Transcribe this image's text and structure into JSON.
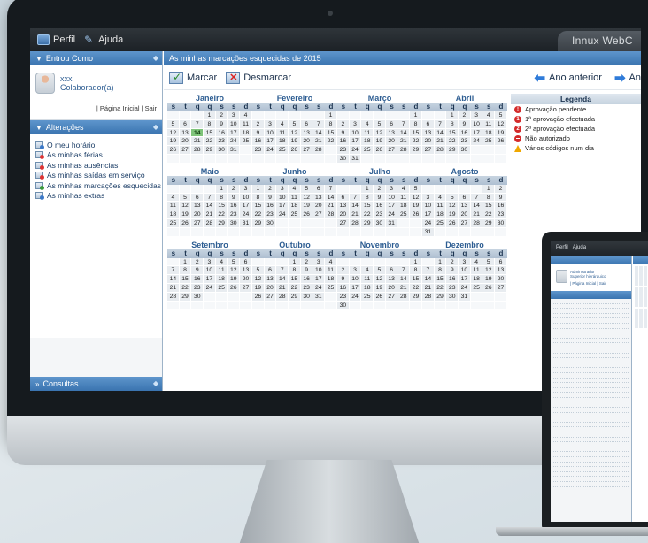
{
  "topbar": {
    "profile_label": "Perfil",
    "help_label": "Ajuda",
    "brand": "Innux WebC"
  },
  "left": {
    "login_header": "Entrou Como",
    "user_name": "xxx",
    "user_role": "Colaborador(a)",
    "user_links": "| Página Inicial | Sair",
    "changes_header": "Alterações",
    "menu": [
      {
        "label": "O meu horário",
        "icon": "blue"
      },
      {
        "label": "As minhas férias",
        "icon": "red"
      },
      {
        "label": "As minhas ausências",
        "icon": "red"
      },
      {
        "label": "As minhas saídas em serviço",
        "icon": "red"
      },
      {
        "label": "As minhas marcações esquecidas",
        "icon": "green"
      },
      {
        "label": "As minhas extras",
        "icon": "blue"
      }
    ],
    "queries_header": "Consultas"
  },
  "main": {
    "header": "As minhas marcações esquecidas de 2015",
    "mark_label": "Marcar",
    "unmark_label": "Desmarcar",
    "prev_label": "Ano anterior",
    "next_label": "An"
  },
  "calendar": {
    "weekday_initials": [
      "s",
      "t",
      "q",
      "q",
      "s",
      "s",
      "d"
    ],
    "months": [
      {
        "name": "Janeiro",
        "offset": 3,
        "days": 31
      },
      {
        "name": "Fevereiro",
        "offset": 6,
        "days": 28
      },
      {
        "name": "Março",
        "offset": 6,
        "days": 31
      },
      {
        "name": "Abril",
        "offset": 2,
        "days": 30
      },
      {
        "name": "Maio",
        "offset": 4,
        "days": 31
      },
      {
        "name": "Junho",
        "offset": 0,
        "days": 30
      },
      {
        "name": "Julho",
        "offset": 2,
        "days": 31
      },
      {
        "name": "Agosto",
        "offset": 5,
        "days": 31
      },
      {
        "name": "Setembro",
        "offset": 1,
        "days": 30
      },
      {
        "name": "Outubro",
        "offset": 3,
        "days": 31
      },
      {
        "name": "Novembro",
        "offset": 6,
        "days": 30
      },
      {
        "name": "Dezembro",
        "offset": 1,
        "days": 31
      }
    ],
    "highlight": {
      "month": 0,
      "day": 14
    }
  },
  "legend": {
    "title": "Legenda",
    "items": [
      {
        "label": "Aprovação pendente",
        "icon": "red-exclamation"
      },
      {
        "label": "1ª aprovação efectuada",
        "icon": "red-1"
      },
      {
        "label": "2ª aprovação efectuada",
        "icon": "red-2"
      },
      {
        "label": "Não autorizado",
        "icon": "red-minus"
      },
      {
        "label": "Vários códigos num dia",
        "icon": "warning"
      }
    ]
  },
  "laptop": {
    "profile_label": "Perfil",
    "help_label": "Ajuda",
    "user_name": "Administrador",
    "user_role": "Superior hierárquico",
    "home_link": "| Página Inicial | Sair"
  }
}
